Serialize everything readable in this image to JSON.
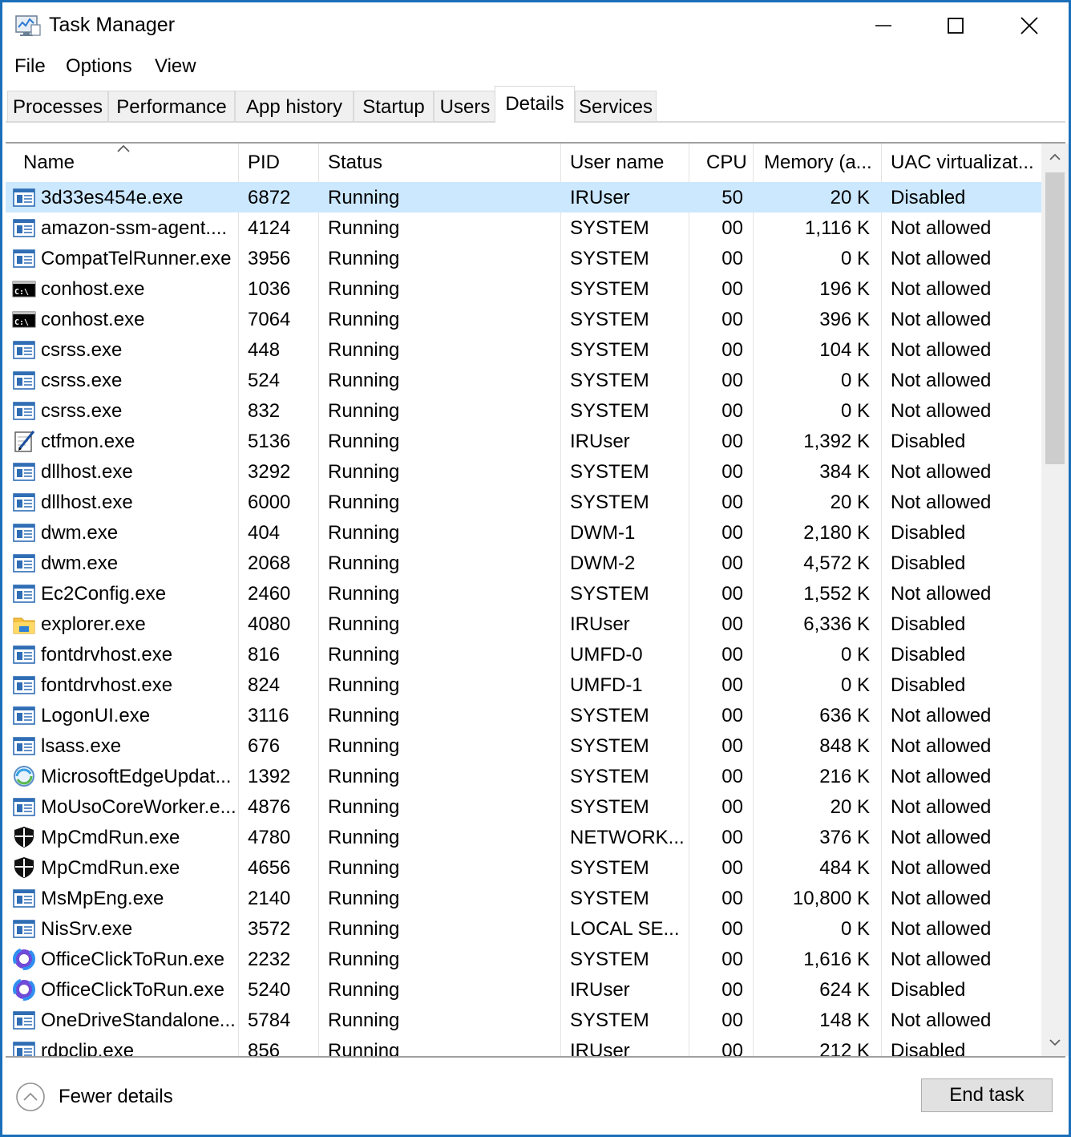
{
  "window": {
    "title": "Task Manager",
    "accent_color": "#1a6fb8"
  },
  "menu": [
    "File",
    "Options",
    "View"
  ],
  "tabs": [
    {
      "label": "Processes",
      "active": false
    },
    {
      "label": "Performance",
      "active": false
    },
    {
      "label": "App history",
      "active": false
    },
    {
      "label": "Startup",
      "active": false
    },
    {
      "label": "Users",
      "active": false
    },
    {
      "label": "Details",
      "active": true
    },
    {
      "label": "Services",
      "active": false
    }
  ],
  "columns": {
    "name": "Name",
    "pid": "PID",
    "status": "Status",
    "user": "User name",
    "cpu": "CPU",
    "memory": "Memory (a...",
    "uac": "UAC virtualizat..."
  },
  "sort": {
    "column": "name",
    "direction": "ascending"
  },
  "selection_color": "#cce8ff",
  "processes": [
    {
      "icon": "app-window-icon",
      "name": "3d33es454e.exe",
      "pid": "6872",
      "status": "Running",
      "user": "IRUser",
      "cpu": "50",
      "memory": "20 K",
      "uac": "Disabled",
      "selected": true
    },
    {
      "icon": "app-window-icon",
      "name": "amazon-ssm-agent....",
      "pid": "4124",
      "status": "Running",
      "user": "SYSTEM",
      "cpu": "00",
      "memory": "1,116 K",
      "uac": "Not allowed"
    },
    {
      "icon": "app-window-icon",
      "name": "CompatTelRunner.exe",
      "pid": "3956",
      "status": "Running",
      "user": "SYSTEM",
      "cpu": "00",
      "memory": "0 K",
      "uac": "Not allowed"
    },
    {
      "icon": "console-icon",
      "name": "conhost.exe",
      "pid": "1036",
      "status": "Running",
      "user": "SYSTEM",
      "cpu": "00",
      "memory": "196 K",
      "uac": "Not allowed"
    },
    {
      "icon": "console-icon",
      "name": "conhost.exe",
      "pid": "7064",
      "status": "Running",
      "user": "SYSTEM",
      "cpu": "00",
      "memory": "396 K",
      "uac": "Not allowed"
    },
    {
      "icon": "app-window-icon",
      "name": "csrss.exe",
      "pid": "448",
      "status": "Running",
      "user": "SYSTEM",
      "cpu": "00",
      "memory": "104 K",
      "uac": "Not allowed"
    },
    {
      "icon": "app-window-icon",
      "name": "csrss.exe",
      "pid": "524",
      "status": "Running",
      "user": "SYSTEM",
      "cpu": "00",
      "memory": "0 K",
      "uac": "Not allowed"
    },
    {
      "icon": "app-window-icon",
      "name": "csrss.exe",
      "pid": "832",
      "status": "Running",
      "user": "SYSTEM",
      "cpu": "00",
      "memory": "0 K",
      "uac": "Not allowed"
    },
    {
      "icon": "pen-notepad-icon",
      "name": "ctfmon.exe",
      "pid": "5136",
      "status": "Running",
      "user": "IRUser",
      "cpu": "00",
      "memory": "1,392 K",
      "uac": "Disabled"
    },
    {
      "icon": "app-window-icon",
      "name": "dllhost.exe",
      "pid": "3292",
      "status": "Running",
      "user": "SYSTEM",
      "cpu": "00",
      "memory": "384 K",
      "uac": "Not allowed"
    },
    {
      "icon": "app-window-icon",
      "name": "dllhost.exe",
      "pid": "6000",
      "status": "Running",
      "user": "SYSTEM",
      "cpu": "00",
      "memory": "20 K",
      "uac": "Not allowed"
    },
    {
      "icon": "app-window-icon",
      "name": "dwm.exe",
      "pid": "404",
      "status": "Running",
      "user": "DWM-1",
      "cpu": "00",
      "memory": "2,180 K",
      "uac": "Disabled"
    },
    {
      "icon": "app-window-icon",
      "name": "dwm.exe",
      "pid": "2068",
      "status": "Running",
      "user": "DWM-2",
      "cpu": "00",
      "memory": "4,572 K",
      "uac": "Disabled"
    },
    {
      "icon": "app-window-icon",
      "name": "Ec2Config.exe",
      "pid": "2460",
      "status": "Running",
      "user": "SYSTEM",
      "cpu": "00",
      "memory": "1,552 K",
      "uac": "Not allowed"
    },
    {
      "icon": "folder-icon",
      "name": "explorer.exe",
      "pid": "4080",
      "status": "Running",
      "user": "IRUser",
      "cpu": "00",
      "memory": "6,336 K",
      "uac": "Disabled"
    },
    {
      "icon": "app-window-icon",
      "name": "fontdrvhost.exe",
      "pid": "816",
      "status": "Running",
      "user": "UMFD-0",
      "cpu": "00",
      "memory": "0 K",
      "uac": "Disabled"
    },
    {
      "icon": "app-window-icon",
      "name": "fontdrvhost.exe",
      "pid": "824",
      "status": "Running",
      "user": "UMFD-1",
      "cpu": "00",
      "memory": "0 K",
      "uac": "Disabled"
    },
    {
      "icon": "app-window-icon",
      "name": "LogonUI.exe",
      "pid": "3116",
      "status": "Running",
      "user": "SYSTEM",
      "cpu": "00",
      "memory": "636 K",
      "uac": "Not allowed"
    },
    {
      "icon": "app-window-icon",
      "name": "lsass.exe",
      "pid": "676",
      "status": "Running",
      "user": "SYSTEM",
      "cpu": "00",
      "memory": "848 K",
      "uac": "Not allowed"
    },
    {
      "icon": "edge-update-icon",
      "name": "MicrosoftEdgeUpdat...",
      "pid": "1392",
      "status": "Running",
      "user": "SYSTEM",
      "cpu": "00",
      "memory": "216 K",
      "uac": "Not allowed"
    },
    {
      "icon": "app-window-icon",
      "name": "MoUsoCoreWorker.e...",
      "pid": "4876",
      "status": "Running",
      "user": "SYSTEM",
      "cpu": "00",
      "memory": "20 K",
      "uac": "Not allowed"
    },
    {
      "icon": "shield-icon",
      "name": "MpCmdRun.exe",
      "pid": "4780",
      "status": "Running",
      "user": "NETWORK...",
      "cpu": "00",
      "memory": "376 K",
      "uac": "Not allowed"
    },
    {
      "icon": "shield-icon",
      "name": "MpCmdRun.exe",
      "pid": "4656",
      "status": "Running",
      "user": "SYSTEM",
      "cpu": "00",
      "memory": "484 K",
      "uac": "Not allowed"
    },
    {
      "icon": "app-window-icon",
      "name": "MsMpEng.exe",
      "pid": "2140",
      "status": "Running",
      "user": "SYSTEM",
      "cpu": "00",
      "memory": "10,800 K",
      "uac": "Not allowed"
    },
    {
      "icon": "app-window-icon",
      "name": "NisSrv.exe",
      "pid": "3572",
      "status": "Running",
      "user": "LOCAL SE...",
      "cpu": "00",
      "memory": "0 K",
      "uac": "Not allowed"
    },
    {
      "icon": "office-icon",
      "name": "OfficeClickToRun.exe",
      "pid": "2232",
      "status": "Running",
      "user": "SYSTEM",
      "cpu": "00",
      "memory": "1,616 K",
      "uac": "Not allowed"
    },
    {
      "icon": "office-icon",
      "name": "OfficeClickToRun.exe",
      "pid": "5240",
      "status": "Running",
      "user": "IRUser",
      "cpu": "00",
      "memory": "624 K",
      "uac": "Disabled"
    },
    {
      "icon": "app-window-icon",
      "name": "OneDriveStandalone...",
      "pid": "5784",
      "status": "Running",
      "user": "SYSTEM",
      "cpu": "00",
      "memory": "148 K",
      "uac": "Not allowed"
    },
    {
      "icon": "app-window-icon",
      "name": "rdpclip.exe",
      "pid": "856",
      "status": "Running",
      "user": "IRUser",
      "cpu": "00",
      "memory": "212 K",
      "uac": "Disabled"
    }
  ],
  "footer": {
    "fewer_details": "Fewer details",
    "end_task": "End task"
  }
}
